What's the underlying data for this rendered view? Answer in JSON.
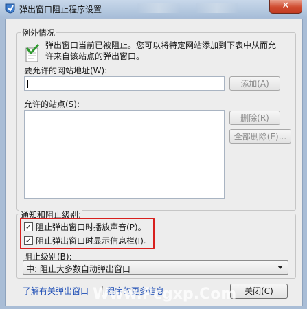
{
  "window": {
    "title": "弹出窗口阻止程序设置",
    "close_glyph": "✕"
  },
  "exceptions": {
    "legend": "例外情况",
    "info_line1": "弹出窗口当前已被阻止。您可以将特定网站添加到下表中从而允",
    "info_line2": "许来自该站点的弹出窗口。",
    "address_label": "要允许的网站地址(W):",
    "address_value": "",
    "add_label": "添加(A)",
    "allowed_label": "允许的站点(S):",
    "remove_label": "删除(R)",
    "remove_all_label": "全部删除(E)..."
  },
  "notify": {
    "legend": "通知和阻止级别:",
    "sound_label": "阻止弹出窗口时播放声音(P)。",
    "sound_checked": true,
    "infobar_label": "阻止弹出窗口时显示信息栏(I)。",
    "infobar_checked": true,
    "level_label": "阻止级别(B):",
    "level_value": "中: 阻止大多数自动弹出窗口"
  },
  "footer": {
    "learn_more_link": "了解有关弹出窗口",
    "learn_more_tail": "程序的更多信息",
    "close_button": "关闭(C)"
  },
  "watermark": "Www.Pcgxp.Com",
  "colors": {
    "highlight_box": "#d8201e",
    "link": "#1a4bb5"
  }
}
